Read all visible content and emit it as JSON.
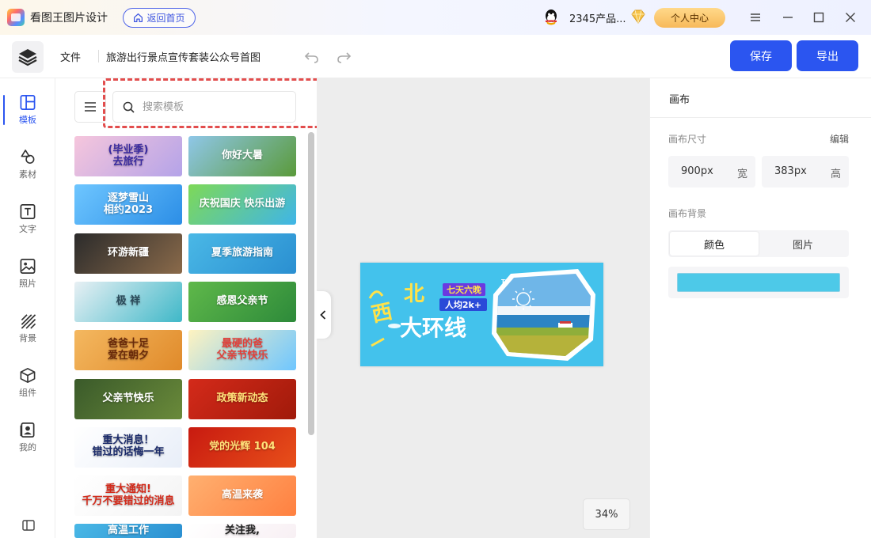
{
  "titlebar": {
    "app_name": "看图王图片设计",
    "home_button": "返回首页",
    "user_name": "2345产品...",
    "personal_center": "个人中心",
    "icons": [
      "app-logo-icon",
      "home-icon",
      "qq-avatar-icon",
      "vip-diamond-icon",
      "menu-icon",
      "minimize-icon",
      "maximize-icon",
      "close-icon"
    ]
  },
  "toolbar": {
    "file_label": "文件",
    "doc_title": "旅游出行景点宣传套装公众号首图",
    "save_label": "保存",
    "export_label": "导出"
  },
  "leftnav": {
    "items": [
      {
        "label": "模板",
        "icon": "layout-icon",
        "active": true
      },
      {
        "label": "素材",
        "icon": "shapes-icon"
      },
      {
        "label": "文字",
        "icon": "text-icon"
      },
      {
        "label": "照片",
        "icon": "image-icon"
      },
      {
        "label": "背景",
        "icon": "background-icon"
      },
      {
        "label": "组件",
        "icon": "cube-icon"
      },
      {
        "label": "我的",
        "icon": "my-folder-icon"
      }
    ]
  },
  "search": {
    "placeholder": "搜索模板",
    "value": ""
  },
  "templates": [
    {
      "text": "(毕业季)\n去旅行",
      "colors": [
        "#f6c6dc",
        "#b4a3e8"
      ],
      "fg": "#3a2aa0"
    },
    {
      "text": "你好大暑",
      "colors": [
        "#8fc7e8",
        "#5a9a3a"
      ],
      "fg": "#ffffff"
    },
    {
      "text": "逐梦雪山\n相约2023",
      "colors": [
        "#6ec6ff",
        "#2c8ee6"
      ],
      "fg": "#ffffff"
    },
    {
      "text": "庆祝国庆 快乐出游",
      "colors": [
        "#7ed957",
        "#3fb5e8"
      ],
      "fg": "#ffffff"
    },
    {
      "text": "环游新疆",
      "colors": [
        "#2b2b2b",
        "#8a6a4a"
      ],
      "fg": "#ffffff"
    },
    {
      "text": "夏季旅游指南",
      "colors": [
        "#4ab8e6",
        "#2a8fd1"
      ],
      "fg": "#ffffff"
    },
    {
      "text": "极 祥",
      "colors": [
        "#e8f0f4",
        "#3fb8c8"
      ],
      "fg": "#2a4a5a"
    },
    {
      "text": "感恩父亲节",
      "colors": [
        "#5fb84a",
        "#2d8a3a"
      ],
      "fg": "#ffffff"
    },
    {
      "text": "爸爸十足\n爱在朝夕",
      "colors": [
        "#f4b860",
        "#e08a2a"
      ],
      "fg": "#6a2a0a"
    },
    {
      "text": "最硬的爸\n父亲节快乐",
      "colors": [
        "#fff3c0",
        "#6ec6ff"
      ],
      "fg": "#e2403a"
    },
    {
      "text": "父亲节快乐",
      "colors": [
        "#3a5a2a",
        "#6a8a3a"
      ],
      "fg": "#ffffff"
    },
    {
      "text": "政策新动态",
      "colors": [
        "#d42a1a",
        "#a01a0a"
      ],
      "fg": "#ffe27a"
    },
    {
      "text": "重大消息！\n错过的话悔一年",
      "colors": [
        "#ffffff",
        "#e8eef8"
      ],
      "fg": "#1a2a6a"
    },
    {
      "text": "党的光辉 104",
      "colors": [
        "#c81a10",
        "#e8501a"
      ],
      "fg": "#ffe27a"
    },
    {
      "text": "重大通知!\n千万不要错过的消息",
      "colors": [
        "#ffffff",
        "#f4f4f4"
      ],
      "fg": "#d42a1a"
    },
    {
      "text": "高温来袭",
      "colors": [
        "#ffb070",
        "#ff8040"
      ],
      "fg": "#ffffff"
    },
    {
      "text": "高温工作",
      "colors": [
        "#4ab8e6",
        "#2a8fd1"
      ],
      "fg": "#ffffff"
    },
    {
      "text": "关注我,",
      "colors": [
        "#ffffff",
        "#f8f0f4"
      ],
      "fg": "#222222"
    }
  ],
  "canvas": {
    "text_west": "西",
    "text_north": "北",
    "text_loop": "大环线",
    "badge_days": "七天六晚",
    "badge_price": "人均2k+",
    "travel_tag": "TRAVEL",
    "bg_color": "#43c2ec",
    "zoom": "34%"
  },
  "right_panel": {
    "header": "画布",
    "size_label": "画布尺寸",
    "edit_label": "编辑",
    "width_value": "900px",
    "width_unit": "宽",
    "height_value": "383px",
    "height_unit": "高",
    "bg_label": "画布背景",
    "tab_color": "颜色",
    "tab_image": "图片",
    "swatch_color": "#4dc9e8"
  },
  "colors": {
    "accent": "#2b55f0",
    "highlight_dash": "#e24d4d"
  }
}
